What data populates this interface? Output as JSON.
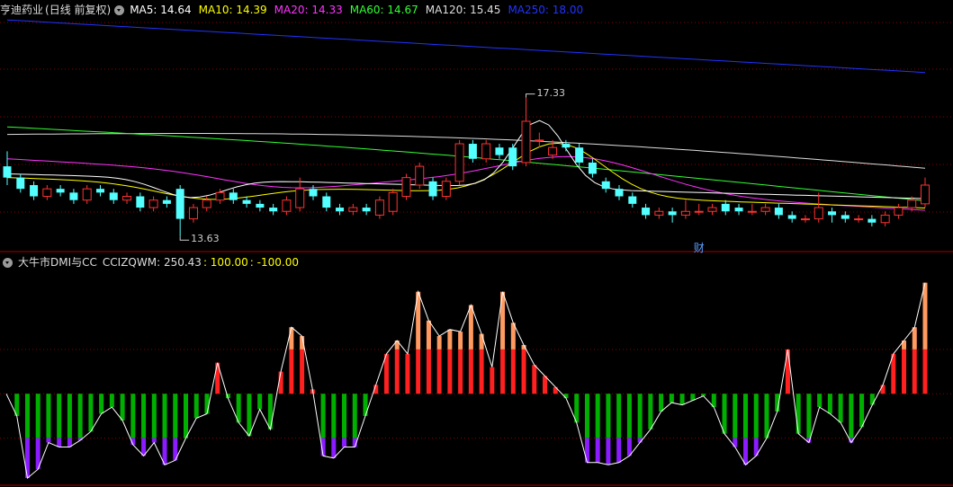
{
  "main_panel": {
    "stock_name": "亨迪药业",
    "period": "(日线 前复权)",
    "ma": [
      {
        "label": "MA5: 14.64",
        "color": "#ffffff"
      },
      {
        "label": "MA10: 14.39",
        "color": "#ffff00"
      },
      {
        "label": "MA20: 14.33",
        "color": "#ff33ff"
      },
      {
        "label": "MA60: 14.67",
        "color": "#33ff33"
      },
      {
        "label": "MA120: 15.45",
        "color": "#dddddd"
      },
      {
        "label": "MA250: 18.00",
        "color": "#2233ff"
      }
    ],
    "high_label": "17.33",
    "low_label": "13.63",
    "event_marker": "财"
  },
  "sub_panel": {
    "indicator": "大牛市DMI与CC",
    "value": "CCIZQWM: 250.43",
    "level_high": ": 100.00",
    "level_low": ": -100.00"
  },
  "colors": {
    "up": "#ff3232",
    "down": "#54ffff",
    "bar_red": "#ff2020",
    "bar_orange": "#ff9a60",
    "bar_green": "#00b000",
    "bar_purple": "#8a1cff",
    "grid": "#880000"
  },
  "chart_data": [
    {
      "type": "candlestick",
      "ylim": [
        13.3,
        19.5
      ],
      "max_marker": 17.33,
      "min_marker": 13.63,
      "series": [
        {
          "name": "MA250",
          "color": "#2233ff",
          "values": [
            19.4,
            18.0
          ]
        },
        {
          "name": "MA120",
          "color": "#dddddd",
          "values": [
            16.35,
            15.45
          ]
        },
        {
          "name": "MA60",
          "color": "#33ff33",
          "values": [
            16.55,
            14.67
          ]
        },
        {
          "name": "MA20",
          "color": "#ff33ff",
          "values": [
            15.7,
            14.33
          ]
        },
        {
          "name": "MA10",
          "color": "#ffff00",
          "values": [
            15.2,
            14.39
          ]
        },
        {
          "name": "MA5",
          "color": "#ffffff",
          "values": [
            15.3,
            14.64
          ]
        }
      ],
      "candles": [
        [
          15.5,
          15.2,
          15.9,
          15.0
        ],
        [
          15.2,
          14.9,
          15.3,
          14.8
        ],
        [
          15.0,
          14.7,
          15.1,
          14.6
        ],
        [
          14.7,
          14.9,
          15.0,
          14.6
        ],
        [
          14.9,
          14.8,
          15.0,
          14.7
        ],
        [
          14.8,
          14.6,
          14.9,
          14.5
        ],
        [
          14.6,
          14.9,
          15.0,
          14.5
        ],
        [
          14.9,
          14.8,
          15.0,
          14.7
        ],
        [
          14.8,
          14.6,
          14.9,
          14.5
        ],
        [
          14.6,
          14.7,
          14.8,
          14.5
        ],
        [
          14.7,
          14.4,
          14.8,
          14.3
        ],
        [
          14.4,
          14.6,
          14.7,
          14.3
        ],
        [
          14.6,
          14.5,
          14.7,
          14.4
        ],
        [
          14.9,
          14.1,
          15.0,
          13.63
        ],
        [
          14.1,
          14.4,
          14.5,
          14.0
        ],
        [
          14.4,
          14.6,
          14.7,
          14.3
        ],
        [
          14.6,
          14.8,
          14.9,
          14.5
        ],
        [
          14.8,
          14.6,
          14.9,
          14.5
        ],
        [
          14.6,
          14.5,
          14.7,
          14.4
        ],
        [
          14.5,
          14.4,
          14.6,
          14.3
        ],
        [
          14.4,
          14.3,
          14.5,
          14.2
        ],
        [
          14.3,
          14.6,
          14.7,
          14.2
        ],
        [
          14.4,
          14.9,
          15.2,
          14.3
        ],
        [
          14.9,
          14.7,
          15.0,
          14.6
        ],
        [
          14.7,
          14.4,
          14.8,
          14.3
        ],
        [
          14.4,
          14.3,
          14.5,
          14.2
        ],
        [
          14.3,
          14.4,
          14.5,
          14.2
        ],
        [
          14.4,
          14.3,
          14.5,
          14.2
        ],
        [
          14.2,
          14.6,
          14.7,
          14.1
        ],
        [
          14.3,
          14.8,
          14.9,
          14.2
        ],
        [
          14.7,
          15.2,
          15.3,
          14.6
        ],
        [
          15.0,
          15.5,
          15.6,
          14.9
        ],
        [
          15.1,
          14.7,
          15.2,
          14.6
        ],
        [
          14.7,
          15.1,
          15.2,
          14.6
        ],
        [
          15.1,
          16.1,
          16.2,
          15.0
        ],
        [
          16.1,
          15.7,
          16.2,
          15.6
        ],
        [
          15.7,
          16.1,
          16.2,
          15.6
        ],
        [
          16.0,
          15.8,
          16.1,
          15.7
        ],
        [
          16.0,
          15.5,
          16.1,
          15.4
        ],
        [
          15.6,
          16.7,
          17.33,
          15.5
        ],
        [
          16.2,
          16.2,
          16.4,
          16.0
        ],
        [
          15.8,
          16.0,
          16.2,
          15.7
        ],
        [
          16.1,
          16.0,
          16.2,
          15.9
        ],
        [
          16.0,
          15.6,
          16.1,
          15.5
        ],
        [
          15.6,
          15.3,
          15.7,
          15.2
        ],
        [
          15.1,
          14.9,
          15.2,
          14.8
        ],
        [
          14.9,
          14.7,
          15.0,
          14.6
        ],
        [
          14.7,
          14.5,
          14.8,
          14.4
        ],
        [
          14.4,
          14.2,
          14.5,
          14.1
        ],
        [
          14.2,
          14.3,
          14.4,
          14.1
        ],
        [
          14.3,
          14.2,
          14.4,
          14.0
        ],
        [
          14.2,
          14.3,
          14.6,
          14.1
        ],
        [
          14.3,
          14.3,
          14.5,
          14.2
        ],
        [
          14.3,
          14.4,
          14.5,
          14.2
        ],
        [
          14.5,
          14.3,
          14.6,
          14.2
        ],
        [
          14.4,
          14.3,
          14.5,
          14.2
        ],
        [
          14.3,
          14.3,
          14.5,
          14.2
        ],
        [
          14.3,
          14.4,
          14.5,
          14.2
        ],
        [
          14.4,
          14.2,
          14.5,
          14.1
        ],
        [
          14.2,
          14.1,
          14.3,
          14.0
        ],
        [
          14.1,
          14.1,
          14.2,
          14.0
        ],
        [
          14.1,
          14.4,
          14.8,
          14.0
        ],
        [
          14.3,
          14.2,
          14.4,
          14.0
        ],
        [
          14.2,
          14.1,
          14.3,
          14.0
        ],
        [
          14.1,
          14.1,
          14.2,
          14.0
        ],
        [
          14.1,
          14.0,
          14.2,
          13.9
        ],
        [
          14.0,
          14.2,
          14.3,
          13.9
        ],
        [
          14.2,
          14.4,
          14.5,
          14.1
        ],
        [
          14.4,
          14.6,
          14.7,
          14.3
        ],
        [
          14.5,
          15.0,
          15.2,
          14.4
        ]
      ],
      "event_index": 52
    },
    {
      "type": "bar",
      "ylim": [
        -200,
        280
      ],
      "levels": [
        100,
        0,
        -100
      ],
      "series": [
        {
          "name": "CCIZQWM",
          "values": [
            0,
            -50,
            -190,
            -170,
            -110,
            -120,
            -120,
            -105,
            -85,
            -45,
            -30,
            -60,
            -115,
            -140,
            -110,
            -160,
            -150,
            -100,
            -55,
            -45,
            70,
            -10,
            -65,
            -95,
            -35,
            -80,
            50,
            150,
            130,
            10,
            -140,
            -145,
            -120,
            -120,
            -50,
            20,
            90,
            120,
            90,
            230,
            165,
            130,
            145,
            140,
            200,
            135,
            60,
            230,
            160,
            110,
            65,
            40,
            15,
            -10,
            -65,
            -155,
            -155,
            -160,
            -155,
            -140,
            -110,
            -80,
            -40,
            -20,
            -25,
            -15,
            -5,
            -30,
            -90,
            -120,
            -160,
            -140,
            -100,
            -40,
            100,
            -90,
            -110,
            -30,
            -45,
            -65,
            -110,
            -75,
            -25,
            20,
            90,
            120,
            150,
            250.43
          ]
        }
      ]
    }
  ]
}
